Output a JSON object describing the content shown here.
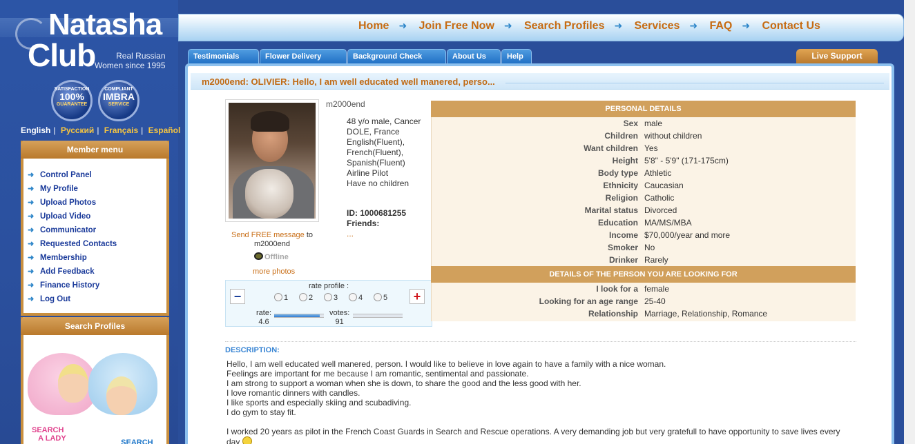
{
  "logo": {
    "line1": "Natasha",
    "line2": "Club",
    "tagline1": "Real Russian",
    "tagline2": "Women since 1995"
  },
  "badges": [
    {
      "top": "SATISFACTION",
      "main": "100%",
      "bottom": "GUARANTEE"
    },
    {
      "top": "COMPLIANT",
      "main": "IMBRA",
      "bottom": "SERVICE"
    }
  ],
  "languages": [
    "English",
    "Русский",
    "Français",
    "Español"
  ],
  "member_menu": {
    "title": "Member menu",
    "items": [
      "Control Panel",
      "My Profile",
      "Upload Photos",
      "Upload Video",
      "Communicator",
      "Requested Contacts",
      "Membership",
      "Add Feedback",
      "Finance History",
      "Log Out"
    ]
  },
  "search_profiles": {
    "title": "Search Profiles",
    "lady": "SEARCH\nA LADY",
    "man": "SEARCH\nA MAN"
  },
  "top_nav": [
    "Home",
    "Join Free Now",
    "Search Profiles",
    "Services",
    "FAQ",
    "Contact Us"
  ],
  "tabs": [
    "Testimonials",
    "Flower Delivery",
    "Background Check",
    "About Us",
    "Help"
  ],
  "live_support": "Live Support",
  "profile": {
    "title": "m2000end: OLIVIER: Hello, I am well educated well manered, perso...",
    "username": "m2000end",
    "summary": [
      "48 y/o male, Cancer",
      "DOLE, France",
      "English(Fluent),",
      "French(Fluent),",
      "Spanish(Fluent)",
      "Airline Pilot",
      "Have no children"
    ],
    "id_label": "ID: 1000681255",
    "friends_label": "Friends:",
    "friends_value": "...",
    "send_msg": {
      "link": "Send FREE message",
      "rest": " to",
      "user": "m2000end"
    },
    "status": "Offline",
    "more_photos": "more photos"
  },
  "rating": {
    "label": "rate profile :",
    "options": [
      "1",
      "2",
      "3",
      "4",
      "5"
    ],
    "rate_label": "rate:",
    "rate_value": "4.6",
    "rate_fraction": 0.92,
    "votes_label": "votes:",
    "votes_value": "91",
    "votes_fraction": 0.0
  },
  "personal_details": {
    "title": "PERSONAL DETAILS",
    "rows": [
      {
        "k": "Sex",
        "v": "male"
      },
      {
        "k": "Children",
        "v": "without children"
      },
      {
        "k": "Want children",
        "v": "Yes"
      },
      {
        "k": "Height",
        "v": "5'8\" - 5'9\" (171-175cm)"
      },
      {
        "k": "Body type",
        "v": "Athletic"
      },
      {
        "k": "Ethnicity",
        "v": "Caucasian"
      },
      {
        "k": "Religion",
        "v": "Catholic"
      },
      {
        "k": "Marital status",
        "v": "Divorced"
      },
      {
        "k": "Education",
        "v": "MA/MS/MBA"
      },
      {
        "k": "Income",
        "v": "$70,000/year and more"
      },
      {
        "k": "Smoker",
        "v": "No"
      },
      {
        "k": "Drinker",
        "v": "Rarely"
      }
    ]
  },
  "looking_for": {
    "title": "DETAILS OF THE PERSON YOU ARE LOOKING FOR",
    "rows": [
      {
        "k": "I look for a",
        "v": "female"
      },
      {
        "k": "Looking for an age range",
        "v": "25-40"
      },
      {
        "k": "Relationship",
        "v": "Marriage, Relationship, Romance"
      }
    ]
  },
  "description": {
    "heading": "DESCRIPTION:",
    "lines": [
      "Hello, I am well educated well manered, person. I would like to believe in love again to have a family with a nice woman.",
      "Feelings are important for me because I am romantic, sentimental and passionate.",
      "I am strong to support a woman when she is down, to share the good and the less good with her.",
      "I love romantic dinners with candles.",
      "I like sports and especially skiing and scubadiving.",
      "I do gym to stay fit."
    ],
    "para2a": "I worked 20 years as pilot in the French Coast Guards in Search and Rescue operations. A very demanding job but very gratefull to have opportunity to save lives every",
    "para2b": "day"
  },
  "colors": {
    "accent_orange": "#c66b12",
    "nav_blue": "#1a3a9a",
    "detail_header": "#d1a05c",
    "left_bg": "#2c55a6"
  }
}
